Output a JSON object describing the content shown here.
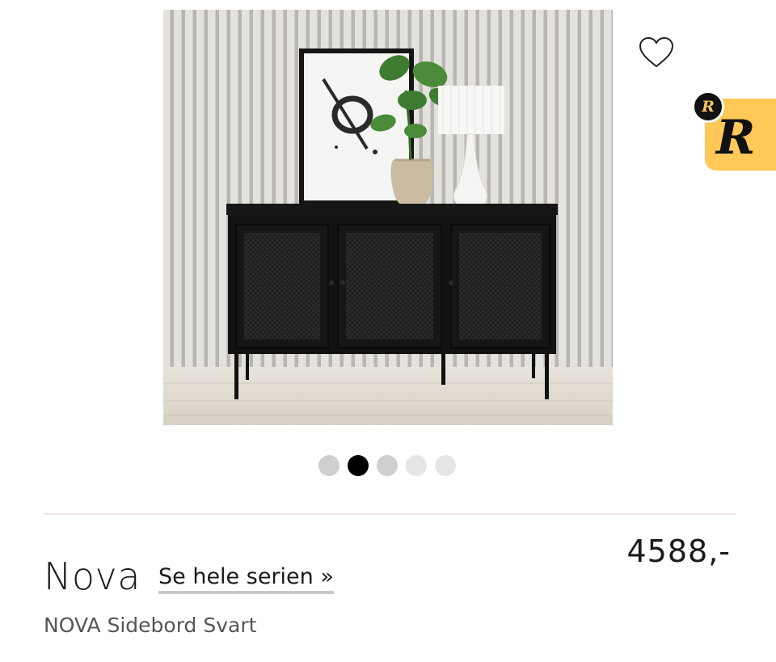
{
  "product": {
    "image_alt": "",
    "price": "4588,-",
    "brand": "Nova",
    "series_link": "Se hele serien »",
    "name": "NOVA Sidebord Svart"
  },
  "carousel": {
    "active_index": 1,
    "dot_colors": [
      "#cfcfcf",
      "#000000",
      "#cfcfcf",
      "#e6e6e6",
      "#e6e6e6"
    ]
  },
  "badge": {
    "small_letter": "R",
    "big_letter": "R",
    "color": "#ffc857"
  },
  "icons": {
    "wishlist": "heart-outline-icon"
  },
  "colors": {
    "text": "#1a1a1a",
    "muted": "#555555",
    "divider": "#efe6e2"
  }
}
